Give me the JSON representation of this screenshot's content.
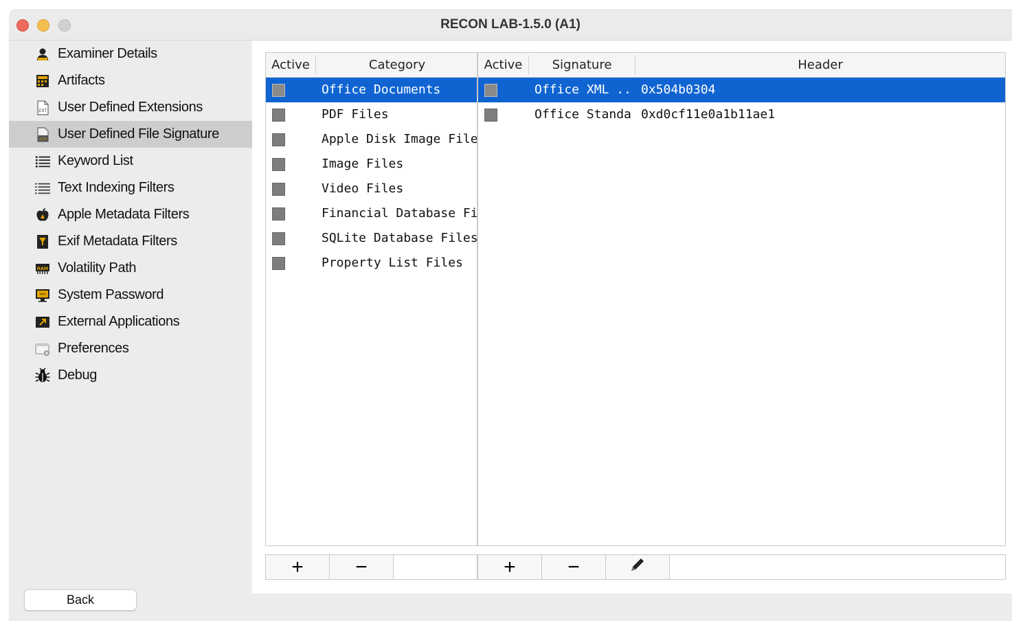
{
  "window": {
    "title": "RECON LAB-1.5.0 (A1)"
  },
  "sidebar": {
    "items": [
      {
        "label": "Examiner Details",
        "icon": "person-icon"
      },
      {
        "label": "Artifacts",
        "icon": "artifacts-icon"
      },
      {
        "label": "User Defined Extensions",
        "icon": "ext-file-icon"
      },
      {
        "label": "User Defined File Signature",
        "icon": "code-file-icon",
        "selected": true
      },
      {
        "label": "Keyword List",
        "icon": "list-icon"
      },
      {
        "label": "Text Indexing Filters",
        "icon": "lines-icon"
      },
      {
        "label": "Apple Metadata Filters",
        "icon": "apple-icon"
      },
      {
        "label": "Exif Metadata Filters",
        "icon": "exif-icon"
      },
      {
        "label": "Volatility Path",
        "icon": "ram-icon"
      },
      {
        "label": "System Password",
        "icon": "monitor-password-icon"
      },
      {
        "label": "External Applications",
        "icon": "external-app-icon"
      },
      {
        "label": "Preferences",
        "icon": "preferences-icon"
      },
      {
        "label": "Debug",
        "icon": "bug-icon"
      }
    ]
  },
  "category_table": {
    "headers": {
      "active": "Active",
      "category": "Category"
    },
    "rows": [
      {
        "category": "Office Documents",
        "selected": true
      },
      {
        "category": "PDF Files"
      },
      {
        "category": "Apple Disk Image Files"
      },
      {
        "category": "Image Files"
      },
      {
        "category": "Video Files"
      },
      {
        "category": "Financial Database Files"
      },
      {
        "category": "SQLite Database Files..."
      },
      {
        "category": "Property List Files"
      }
    ],
    "buttons": {
      "add": "+",
      "remove": "−"
    }
  },
  "signature_table": {
    "headers": {
      "active": "Active",
      "signature": "Signature",
      "header": "Header"
    },
    "rows": [
      {
        "signature": "Office XML ...",
        "header": "0x504b0304",
        "selected": true
      },
      {
        "signature": "Office Standa...",
        "header": "0xd0cf11e0a1b11ae1"
      }
    ],
    "buttons": {
      "add": "+",
      "remove": "−",
      "edit": "pencil-icon"
    }
  },
  "footer": {
    "back_label": "Back"
  },
  "colors": {
    "selection": "#0f64d2",
    "sidebar_selected": "#cdcdcd",
    "checkbox": "#7d7d7d"
  }
}
